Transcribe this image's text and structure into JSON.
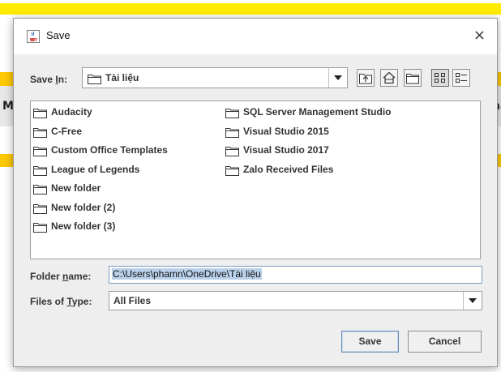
{
  "window": {
    "title": "Save",
    "close_glyph": "×"
  },
  "background": {
    "left_letter": "M",
    "right_letter": "na"
  },
  "save_in": {
    "label_prefix": "Save ",
    "label_key": "I",
    "label_suffix": "n:",
    "value": "Tài liệu"
  },
  "toolbar": {
    "buttons": [
      {
        "name": "up-one-level",
        "icon": "folder-up-icon"
      },
      {
        "name": "home",
        "icon": "home-icon"
      },
      {
        "name": "create-new-folder",
        "icon": "new-folder-icon"
      },
      {
        "name": "list-view",
        "icon": "list-view-icon",
        "active": true
      },
      {
        "name": "details-view",
        "icon": "details-view-icon"
      }
    ]
  },
  "files": {
    "column1": [
      "Audacity",
      "C-Free",
      "Custom Office Templates",
      "League of Legends",
      "New folder",
      "New folder (2)",
      "New folder (3)"
    ],
    "column2": [
      "SQL Server Management Studio",
      "Visual Studio 2015",
      "Visual Studio 2017",
      "Zalo Received Files"
    ]
  },
  "folder_name": {
    "label_prefix": "Folder ",
    "label_key": "n",
    "label_suffix": "ame:",
    "value": "C:\\Users\\phamn\\OneDrive\\Tài liệu"
  },
  "files_of_type": {
    "label_prefix": "Files of ",
    "label_key": "T",
    "label_suffix": "ype:",
    "value": "All Files"
  },
  "buttons": {
    "save": "Save",
    "cancel": "Cancel"
  },
  "colors": {
    "yellow_band": "#ffeb00",
    "orange_band": "#ffc800",
    "dialog_bg": "#eeeeee",
    "selection": "#b9d1ea"
  }
}
